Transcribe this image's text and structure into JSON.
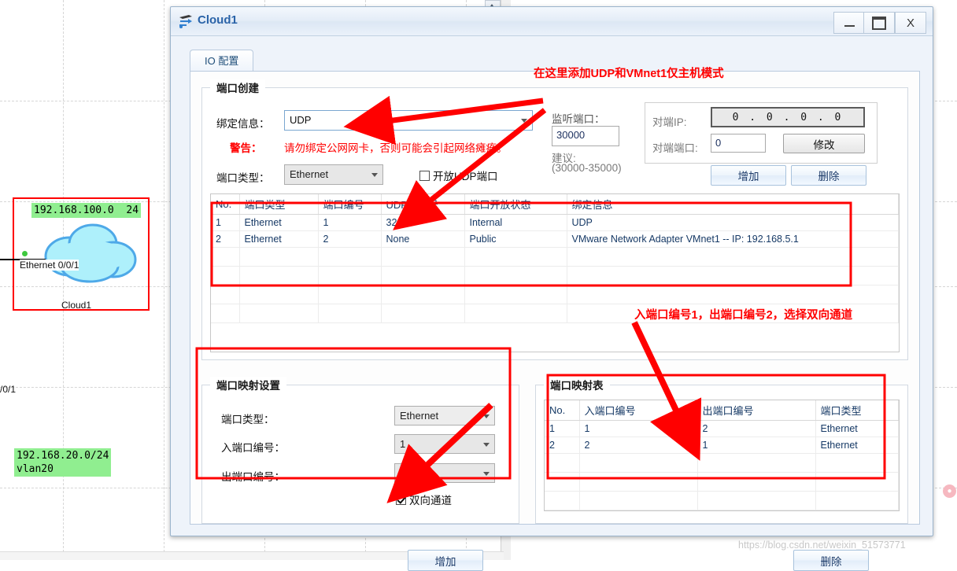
{
  "background": {
    "nodes": [
      {
        "ip_label": "192.168.100.0  24",
        "device_label": "Cloud1",
        "interface_label": "Ethernet 0/0/1"
      },
      {
        "ip_label": "192.168.20.0/24\nvlan20",
        "interface_label": "/0/1"
      }
    ],
    "watermark": "https://blog.csdn.net/weixin_51573771"
  },
  "window": {
    "title": "Cloud1",
    "icon": "cloud-device-icon",
    "minimize_label": "_",
    "maximize_label": "❐",
    "close_label": "X"
  },
  "tabs": [
    {
      "label": "IO 配置",
      "selected": true
    }
  ],
  "port_create": {
    "title": "端口创建",
    "binding_info_label": "绑定信息：",
    "binding_info_value": "UDP",
    "warning_label": "警告：",
    "warning_text": "请勿绑定公网网卡，否则可能会引起网络瘫痪。",
    "port_type_label": "端口类型：",
    "port_type_value": "Ethernet",
    "open_udp_checkbox_label": "开放UDP端口",
    "open_udp_checked": false,
    "listen_port_label": "监听端口：",
    "listen_port_value": "30000",
    "suggest_label": "建议:",
    "suggest_range": "(30000-35000)",
    "peer_ip_label": "对端IP:",
    "peer_ip_value": "0 . 0 . 0 . 0",
    "peer_port_label": "对端端口:",
    "peer_port_value": "0",
    "modify_button": "修改",
    "add_button": "增加",
    "delete_button": "删除"
  },
  "port_table": {
    "columns": [
      "No.",
      "端口类型",
      "端口编号",
      "UDP端口号",
      "端口开放状态",
      "绑定信息"
    ],
    "rows": [
      [
        "1",
        "Ethernet",
        "1",
        "3245",
        "Internal",
        "UDP"
      ],
      [
        "2",
        "Ethernet",
        "2",
        "None",
        "Public",
        "VMware Network Adapter VMnet1 -- IP: 192.168.5.1"
      ],
      [
        "",
        "",
        "",
        "",
        "",
        ""
      ],
      [
        "",
        "",
        "",
        "",
        "",
        ""
      ],
      [
        "",
        "",
        "",
        "",
        "",
        ""
      ],
      [
        "",
        "",
        "",
        "",
        "",
        ""
      ]
    ]
  },
  "port_map_settings": {
    "title": "端口映射设置",
    "port_type_label": "端口类型：",
    "port_type_value": "Ethernet",
    "in_port_label": "入端口编号：",
    "in_port_value": "1",
    "out_port_label": "出端口编号：",
    "out_port_value": "2",
    "bidirectional_label": "双向通道",
    "bidirectional_checked": true,
    "add_button": "增加"
  },
  "port_map_table": {
    "title": "端口映射表",
    "columns": [
      "No.",
      "入端口编号",
      "出端口编号",
      "端口类型"
    ],
    "rows": [
      [
        "1",
        "1",
        "2",
        "Ethernet"
      ],
      [
        "2",
        "2",
        "1",
        "Ethernet"
      ],
      [
        "",
        "",
        "",
        ""
      ],
      [
        "",
        "",
        "",
        ""
      ],
      [
        "",
        "",
        "",
        ""
      ]
    ],
    "delete_button": "删除"
  },
  "annotations": [
    {
      "text": "在这里添加UDP和VMnet1仅主机模式"
    },
    {
      "text": "入端口编号1，出端口编号2，选择双向通道"
    }
  ],
  "colors": {
    "annotation_red": "#ff0000",
    "title_blue": "#2a63a8",
    "ip_green": "#90ee90"
  }
}
